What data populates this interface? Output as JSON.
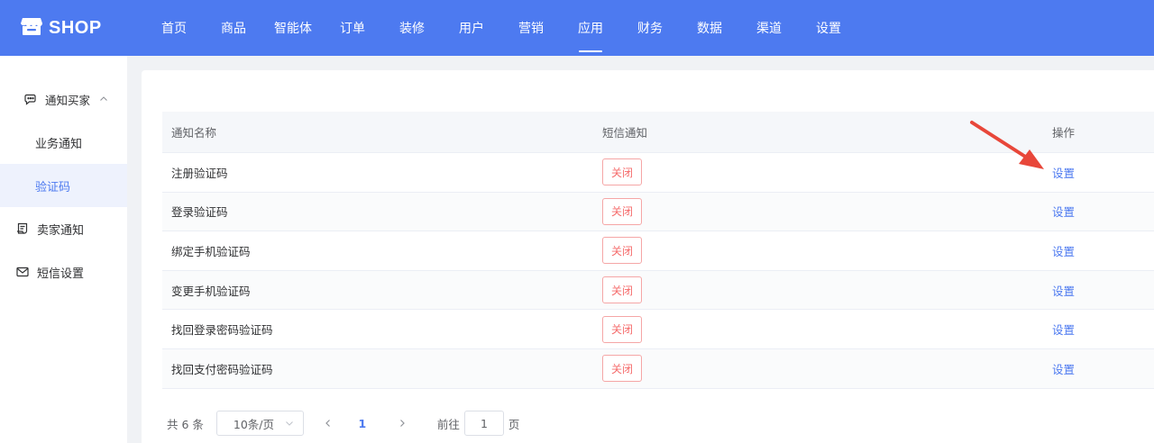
{
  "brand": {
    "name": "SHOP"
  },
  "nav": {
    "items": [
      {
        "label": "首页"
      },
      {
        "label": "商品"
      },
      {
        "label": "智能体"
      },
      {
        "label": "订单"
      },
      {
        "label": "装修"
      },
      {
        "label": "用户"
      },
      {
        "label": "营销"
      },
      {
        "label": "应用",
        "active": true
      },
      {
        "label": "财务"
      },
      {
        "label": "数据"
      },
      {
        "label": "渠道"
      },
      {
        "label": "设置"
      }
    ]
  },
  "sidebar": {
    "group": {
      "label": "通知买家",
      "icon": "chat-bubble-icon",
      "expanded": true
    },
    "subitems": [
      {
        "label": "业务通知"
      },
      {
        "label": "验证码",
        "active": true
      }
    ],
    "items": [
      {
        "label": "卖家通知",
        "icon": "receipt-icon"
      },
      {
        "label": "短信设置",
        "icon": "envelope-icon"
      }
    ]
  },
  "table": {
    "headers": {
      "name": "通知名称",
      "sms": "短信通知",
      "action": "操作"
    },
    "rows": [
      {
        "name": "注册验证码",
        "sms": "关闭",
        "action": "设置"
      },
      {
        "name": "登录验证码",
        "sms": "关闭",
        "action": "设置"
      },
      {
        "name": "绑定手机验证码",
        "sms": "关闭",
        "action": "设置"
      },
      {
        "name": "变更手机验证码",
        "sms": "关闭",
        "action": "设置"
      },
      {
        "name": "找回登录密码验证码",
        "sms": "关闭",
        "action": "设置"
      },
      {
        "name": "找回支付密码验证码",
        "sms": "关闭",
        "action": "设置"
      }
    ]
  },
  "pagination": {
    "total": "共 6 条",
    "page_size": "10条/页",
    "current": "1",
    "goto_prefix": "前往",
    "goto_value": "1",
    "goto_suffix": "页"
  },
  "colors": {
    "primary": "#4d7af0",
    "danger": "#f56c6c",
    "annotation": "#e8473a"
  }
}
